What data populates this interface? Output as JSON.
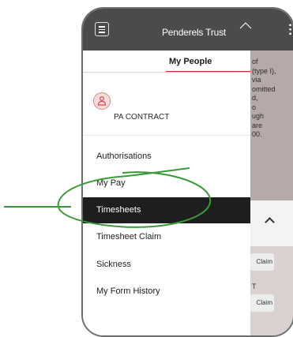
{
  "header": {
    "brand": "Penderels Trust"
  },
  "drawer": {
    "tab": "My People",
    "profile_name": "PA CONTRACT",
    "nav_items": [
      {
        "label": "Authorisations"
      },
      {
        "label": "My Pay"
      },
      {
        "label": "Timesheets"
      },
      {
        "label": "Timesheet Claim"
      },
      {
        "label": "Sickness"
      },
      {
        "label": "My Form History"
      }
    ],
    "active_item": "Timesheets"
  },
  "background_page": {
    "text_lines": [
      "of",
      "(type I),",
      "via",
      "omitted",
      "d,",
      "o",
      "ugh",
      "are",
      "00."
    ],
    "claim_buttons": [
      "Claim",
      "Claim"
    ],
    "stray_text": "T"
  },
  "colors": {
    "header_bg": "#4b4b4b",
    "accent": "#c62828",
    "active_bg": "#1e1e1e",
    "annotation": "#3a9a3a"
  },
  "icons": {
    "menu": "hamburger-menu-icon",
    "more": "kebab-menu-icon",
    "avatar": "user-icon",
    "chevron": "chevron-up-icon"
  }
}
